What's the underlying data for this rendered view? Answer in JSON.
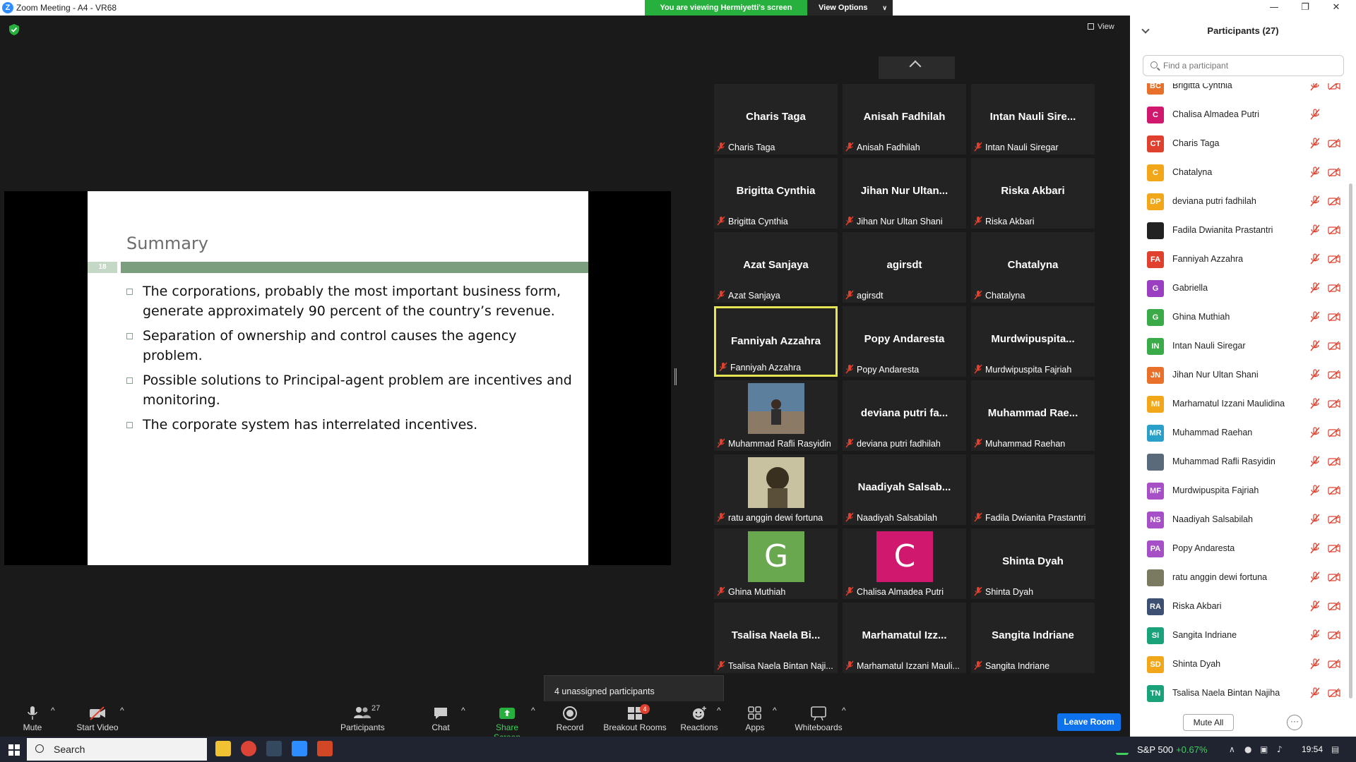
{
  "window": {
    "app_title": "Zoom Meeting - A4 - VR68",
    "viewing_banner": "You are viewing Hermiyetti's screen",
    "view_options": "View Options"
  },
  "meeting": {
    "view_label": "View"
  },
  "slide": {
    "title": "Summary",
    "page_number": "18",
    "bullets": [
      "The corporations, probably the most important business form, generate approximately 90 percent of the country’s revenue.",
      "Separation of ownership and control causes the agency problem.",
      "Possible solutions to Principal-agent problem are incentives and monitoring.",
      "The corporate system has interrelated incentives."
    ]
  },
  "gallery": {
    "tiles": [
      {
        "big": "Charis Taga",
        "name": "Charis Taga"
      },
      {
        "big": "Anisah Fadhilah",
        "name": "Anisah Fadhilah"
      },
      {
        "big": "Intan Nauli Sire...",
        "name": "Intan Nauli Siregar"
      },
      {
        "big": "Brigitta Cynthia",
        "name": "Brigitta Cynthia"
      },
      {
        "big": "Jihan Nur Ultan...",
        "name": "Jihan Nur Ultan Shani"
      },
      {
        "big": "Riska Akbari",
        "name": "Riska Akbari"
      },
      {
        "big": "Azat Sanjaya",
        "name": "Azat Sanjaya"
      },
      {
        "big": "agirsdt",
        "name": "agirsdt"
      },
      {
        "big": "Chatalyna",
        "name": "Chatalyna"
      },
      {
        "big": "Fanniyah Azzahra",
        "name": "Fanniyah Azzahra"
      },
      {
        "big": "Popy Andaresta",
        "name": "Popy Andaresta"
      },
      {
        "big": "Murdwipuspita...",
        "name": "Murdwipuspita Fajriah"
      },
      {
        "big": "",
        "name": "Muhammad Rafli Rasyidin"
      },
      {
        "big": "deviana putri fa...",
        "name": "deviana putri fadhilah"
      },
      {
        "big": "Muhammad Rae...",
        "name": "Muhammad Raehan"
      },
      {
        "big": "",
        "name": "ratu anggin dewi fortuna"
      },
      {
        "big": "Naadiyah Salsab...",
        "name": "Naadiyah Salsabilah"
      },
      {
        "big": "",
        "name": "Fadila Dwianita Prastantri"
      },
      {
        "big": "",
        "name": "Ghina Muthiah",
        "avatar": "G"
      },
      {
        "big": "",
        "name": "Chalisa Almadea Putri",
        "avatar": "C"
      },
      {
        "big": "Shinta Dyah",
        "name": "Shinta Dyah"
      },
      {
        "big": "Tsalisa Naela Bi...",
        "name": "Tsalisa Naela Bintan Naji..."
      },
      {
        "big": "Marhamatul Izz...",
        "name": "Marhamatul Izzani Mauli..."
      },
      {
        "big": "Sangita Indriane",
        "name": "Sangita Indriane"
      }
    ],
    "avatar_colors": {
      "G": "#6aa84f",
      "C": "#d0186f"
    }
  },
  "tooltip": "4 unassigned participants",
  "toolbar": {
    "mute": "Mute",
    "start_video": "Start Video",
    "participants": "Participants",
    "participants_count": "27",
    "chat": "Chat",
    "share_screen": "Share Screen",
    "record": "Record",
    "breakout_rooms": "Breakout Rooms",
    "breakout_badge": "4",
    "reactions": "Reactions",
    "apps": "Apps",
    "whiteboards": "Whiteboards",
    "leave_room": "Leave Room"
  },
  "participants_panel": {
    "header": "Participants (27)",
    "search_placeholder": "Find a participant",
    "mute_all": "Mute All",
    "more": "···",
    "list": [
      {
        "initials": "BC",
        "name": "Brigitta Cynthia",
        "color": "#e8702a",
        "cam": true
      },
      {
        "initials": "C",
        "name": "Chalisa Almadea Putri",
        "color": "#d0186f",
        "cam": false
      },
      {
        "initials": "CT",
        "name": "Charis Taga",
        "color": "#e0412e",
        "cam": true
      },
      {
        "initials": "C",
        "name": "Chatalyna",
        "color": "#f2a71b",
        "cam": true
      },
      {
        "initials": "DP",
        "name": "deviana putri fadhilah",
        "color": "#f2a71b",
        "cam": true
      },
      {
        "initials": "",
        "name": "Fadila Dwianita Prastantri",
        "color": "#222222",
        "cam": true
      },
      {
        "initials": "FA",
        "name": "Fanniyah Azzahra",
        "color": "#e0412e",
        "cam": true
      },
      {
        "initials": "G",
        "name": "Gabriella",
        "color": "#9b3fc2",
        "cam": true
      },
      {
        "initials": "G",
        "name": "Ghina Muthiah",
        "color": "#3bab4a",
        "cam": true
      },
      {
        "initials": "IN",
        "name": "Intan Nauli Siregar",
        "color": "#3bab4a",
        "cam": true
      },
      {
        "initials": "JN",
        "name": "Jihan Nur Ultan Shani",
        "color": "#e8702a",
        "cam": true
      },
      {
        "initials": "MI",
        "name": "Marhamatul Izzani Maulidina",
        "color": "#f2a71b",
        "cam": true
      },
      {
        "initials": "MR",
        "name": "Muhammad Raehan",
        "color": "#2aa0c8",
        "cam": true
      },
      {
        "initials": "",
        "name": "Muhammad Rafli Rasyidin",
        "color": "#5a6a7a",
        "cam": true
      },
      {
        "initials": "MF",
        "name": "Murdwipuspita Fajriah",
        "color": "#a64fc6",
        "cam": true
      },
      {
        "initials": "NS",
        "name": "Naadiyah Salsabilah",
        "color": "#a64fc6",
        "cam": true
      },
      {
        "initials": "PA",
        "name": "Popy Andaresta",
        "color": "#a64fc6",
        "cam": true
      },
      {
        "initials": "",
        "name": "ratu anggin dewi fortuna",
        "color": "#7a7a60",
        "cam": true
      },
      {
        "initials": "RA",
        "name": "Riska Akbari",
        "color": "#3d4f73",
        "cam": true
      },
      {
        "initials": "SI",
        "name": "Sangita Indriane",
        "color": "#1aa37a",
        "cam": true
      },
      {
        "initials": "SD",
        "name": "Shinta Dyah",
        "color": "#f2a71b",
        "cam": true
      },
      {
        "initials": "TN",
        "name": "Tsalisa Naela Bintan Najiha",
        "color": "#1aa37a",
        "cam": true
      }
    ]
  },
  "taskbar": {
    "search": "Search",
    "stock_name": "S&P 500",
    "stock_change": "+0.67%",
    "time": "19:54"
  }
}
